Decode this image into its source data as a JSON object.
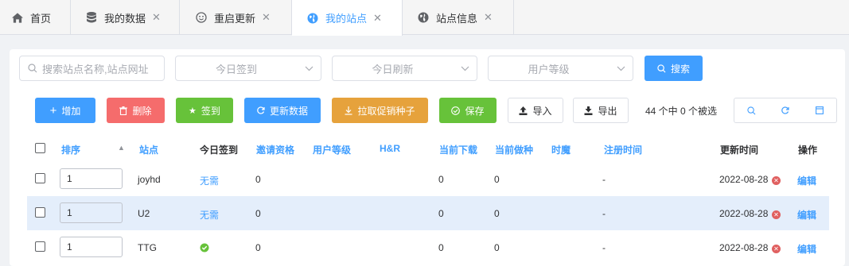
{
  "tabs": [
    {
      "label": "首页",
      "icon": "home-icon",
      "closable": false
    },
    {
      "label": "我的数据",
      "icon": "database-icon",
      "closable": true
    },
    {
      "label": "重启更新",
      "icon": "smile-icon",
      "closable": true
    },
    {
      "label": "我的站点",
      "icon": "globe-icon",
      "closable": true,
      "active": true
    },
    {
      "label": "站点信息",
      "icon": "globe-icon",
      "closable": true
    }
  ],
  "filters": {
    "search_placeholder": "搜索站点名称,站点网址",
    "sign_today": "今日签到",
    "refresh_today": "今日刷新",
    "user_level": "用户等级",
    "search_button": "搜索"
  },
  "toolbar": {
    "add": "增加",
    "delete": "删除",
    "sign": "签到",
    "update": "更新数据",
    "pull_promo": "拉取促销种子",
    "save": "保存",
    "import": "导入",
    "export": "导出",
    "selection_status": "44 个中 0 个被选"
  },
  "table": {
    "headers": {
      "sort": "排序",
      "site": "站点",
      "sign_today": "今日签到",
      "invite": "邀请资格",
      "user_level": "用户等级",
      "hr": "H&R",
      "downloading": "当前下载",
      "seeding": "当前做种",
      "time_magic": "时魔",
      "register_time": "注册时间",
      "update_time": "更新时间",
      "action": "操作"
    },
    "rows": [
      {
        "order": "1",
        "site": "joyhd",
        "sign": "无需",
        "invite": "0",
        "downloading": "0",
        "seeding": "0",
        "register": "-",
        "updated": "2022-08-28",
        "edit": "编辑"
      },
      {
        "order": "1",
        "site": "U2",
        "sign": "无需",
        "invite": "0",
        "downloading": "0",
        "seeding": "0",
        "register": "-",
        "updated": "2022-08-28",
        "edit": "编辑"
      },
      {
        "order": "1",
        "site": "TTG",
        "sign": "",
        "sign_icon": "check-circle-icon",
        "invite": "0",
        "downloading": "0",
        "seeding": "0",
        "register": "-",
        "updated": "2022-08-28",
        "edit": "编辑"
      }
    ]
  },
  "colors": {
    "primary": "#409eff",
    "danger": "#f56c6c",
    "success": "#67c23a",
    "warning": "#e6a23c",
    "highlight_row": "#e4eefb"
  }
}
